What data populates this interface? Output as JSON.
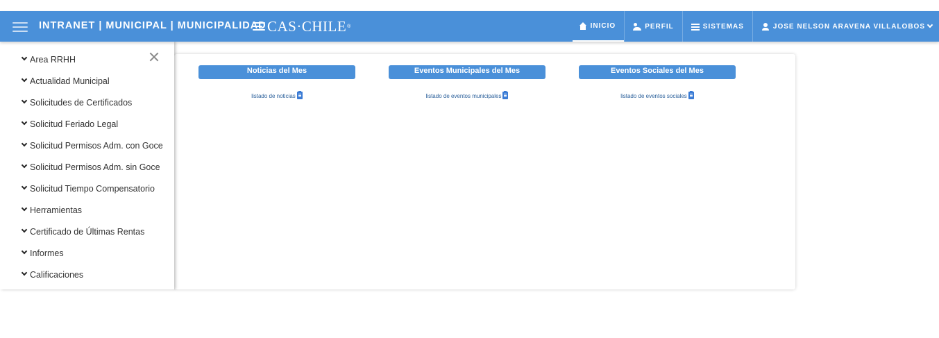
{
  "colors": {
    "accent": "#4a90d9",
    "background": "#ffffff"
  },
  "navbar": {
    "brand": "INTRANET | MUNICIPAL |   MUNICIPALIDAD",
    "logo_text": "CAS·CHILE",
    "logo_mark": "®",
    "items": [
      {
        "label": "INICIO",
        "icon": "home-icon",
        "active": true
      },
      {
        "label": "PERFIL",
        "icon": "users-icon"
      },
      {
        "label": "SISTEMAS",
        "icon": "list-icon"
      },
      {
        "label": "JOSE NELSON ARAVENA VILLALOBOS",
        "icon": "user-icon"
      }
    ]
  },
  "sidebar": {
    "items": [
      {
        "label": "Area RRHH"
      },
      {
        "label": "Actualidad Municipal"
      },
      {
        "label": "Solicitudes de Certificados"
      },
      {
        "label": "Solicitud Feriado Legal"
      },
      {
        "label": "Solicitud Permisos Adm. con Goce"
      },
      {
        "label": "Solicitud Permisos Adm. sin Goce"
      },
      {
        "label": "Solicitud Tiempo Compensatorio"
      },
      {
        "label": "Herramientas"
      },
      {
        "label": "Certificado de Últimas Rentas"
      },
      {
        "label": "Informes"
      },
      {
        "label": "Calificaciones"
      }
    ]
  },
  "main": {
    "columns": [
      {
        "title": "Noticias del Mes",
        "link": "listado de noticias"
      },
      {
        "title": "Eventos Municipales del Mes",
        "link": "listado de eventos municipales"
      },
      {
        "title": "Eventos Sociales del Mes",
        "link": "listado de eventos sociales"
      }
    ]
  }
}
